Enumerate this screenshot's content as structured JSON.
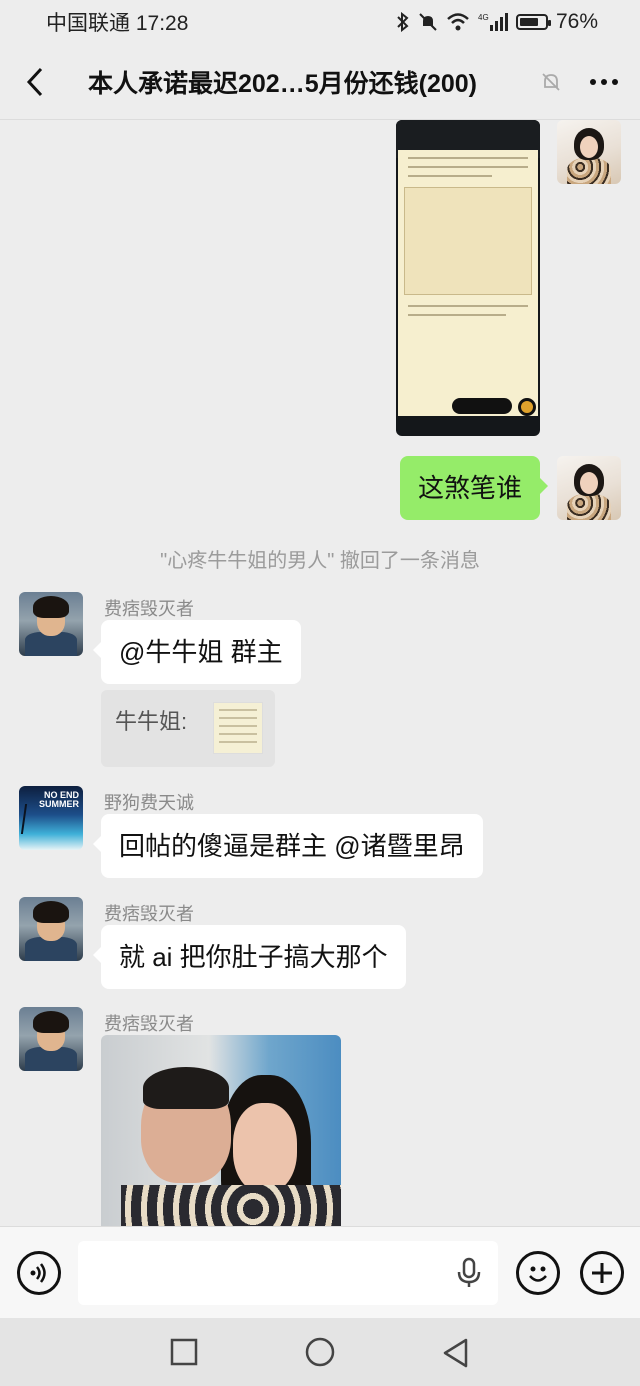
{
  "status_bar": {
    "carrier_time": "中国联通 17:28",
    "battery_percent": "76%",
    "battery_level": 0.76,
    "network": "4G"
  },
  "header": {
    "title": "本人承诺最迟202…5月份还钱(200)"
  },
  "messages": {
    "reply_text": "这煞笔谁",
    "recall_notice": "\"心疼牛牛姐的男人\" 撤回了一条消息",
    "msg1": {
      "sender": "费痞毁灭者",
      "text": "@牛牛姐  群主",
      "quote_label": "牛牛姐:"
    },
    "msg2": {
      "sender": "野狗费天诚",
      "text": "回帖的傻逼是群主 @诸暨里昂"
    },
    "msg3": {
      "sender": "费痞毁灭者",
      "text": "就 ai 把你肚子搞大那个"
    },
    "msg4": {
      "sender": "费痞毁灭者"
    }
  },
  "avatars": {
    "summer_text": "NO END SUMMER"
  },
  "input": {
    "value": ""
  },
  "colors": {
    "bg": "#ededed",
    "green_bubble": "#95ec69",
    "white_bubble": "#ffffff"
  }
}
